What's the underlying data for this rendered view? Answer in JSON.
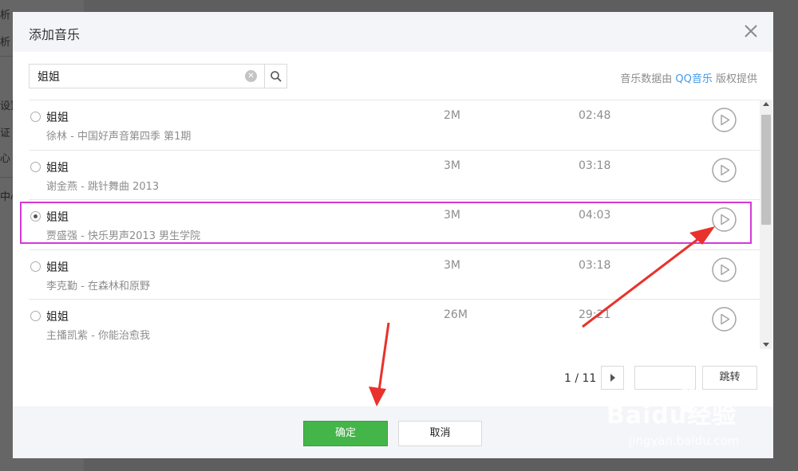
{
  "background": {
    "fragments": [
      "析",
      "析",
      "设置",
      "证",
      "心",
      "中心"
    ]
  },
  "dialog": {
    "title": "添加音乐",
    "close_icon": "close-icon"
  },
  "search": {
    "value": "姐姐",
    "placeholder": "",
    "clear_icon": "clear-circle-icon",
    "search_icon": "search-icon"
  },
  "copyright": {
    "prefix": "音乐数据由",
    "brand": "QQ音乐",
    "suffix": "版权提供"
  },
  "songs": [
    {
      "title": "姐姐",
      "subtitle": "徐林 - 中国好声音第四季 第1期",
      "size": "2M",
      "duration": "02:48",
      "selected": false
    },
    {
      "title": "姐姐",
      "subtitle": "谢金燕 - 跳针舞曲 2013",
      "size": "3M",
      "duration": "03:18",
      "selected": false
    },
    {
      "title": "姐姐",
      "subtitle": "贾盛强 - 快乐男声2013 男生学院",
      "size": "3M",
      "duration": "04:03",
      "selected": true
    },
    {
      "title": "姐姐",
      "subtitle": "李克勤 - 在森林和原野",
      "size": "3M",
      "duration": "03:18",
      "selected": false
    },
    {
      "title": "姐姐",
      "subtitle": "主播凯紫 - 你能治愈我",
      "size": "26M",
      "duration": "29:21",
      "selected": false
    }
  ],
  "pager": {
    "text": "1 / 11",
    "input_value": "",
    "jump_label": "跳转"
  },
  "footer": {
    "ok_label": "确定",
    "cancel_label": "取消"
  },
  "watermark": {
    "main": "Baidu经验",
    "sub": "jingyan.baidu.com"
  },
  "colors": {
    "accent_green": "#44b549",
    "link_blue": "#459ae9",
    "highlight_magenta": "#d33ad6",
    "arrow_red": "#e8322b"
  }
}
